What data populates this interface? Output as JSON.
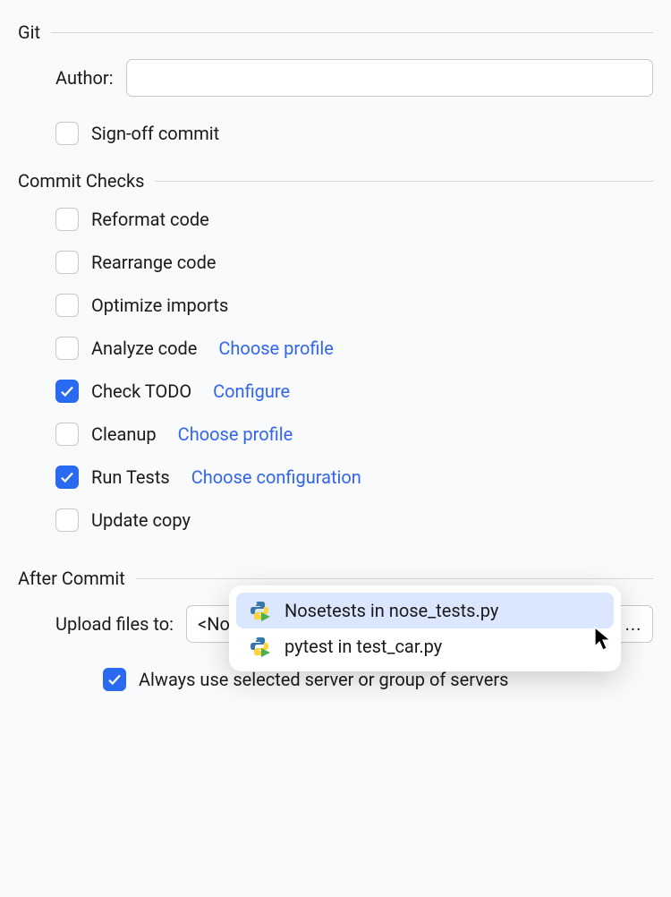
{
  "sections": {
    "git": {
      "title": "Git",
      "author_label": "Author:",
      "author_value": "",
      "signoff_label": "Sign-off commit",
      "signoff_checked": false
    },
    "commit_checks": {
      "title": "Commit Checks",
      "items": {
        "reformat": {
          "label": "Reformat code",
          "checked": false
        },
        "rearrange": {
          "label": "Rearrange code",
          "checked": false
        },
        "optimize": {
          "label": "Optimize imports",
          "checked": false
        },
        "analyze": {
          "label": "Analyze code",
          "checked": false,
          "link": "Choose profile"
        },
        "check_todo": {
          "label": "Check TODO",
          "checked": true,
          "link": "Configure"
        },
        "cleanup": {
          "label": "Cleanup",
          "checked": false,
          "link": "Choose profile"
        },
        "run_tests": {
          "label": "Run Tests",
          "checked": true,
          "link": "Choose configuration"
        },
        "update_copy": {
          "label": "Update copy",
          "checked": false
        }
      }
    },
    "after_commit": {
      "title": "After Commit",
      "upload_label": "Upload files to:",
      "upload_value": "<None>",
      "more_button": "...",
      "always_label": "Always use selected server or group of servers",
      "always_checked": true
    }
  },
  "popup": {
    "items": [
      {
        "label": "Nosetests in nose_tests.py",
        "highlighted": true,
        "icon": "python-run-icon"
      },
      {
        "label": "pytest in test_car.py",
        "highlighted": false,
        "icon": "python-run-icon"
      }
    ]
  }
}
